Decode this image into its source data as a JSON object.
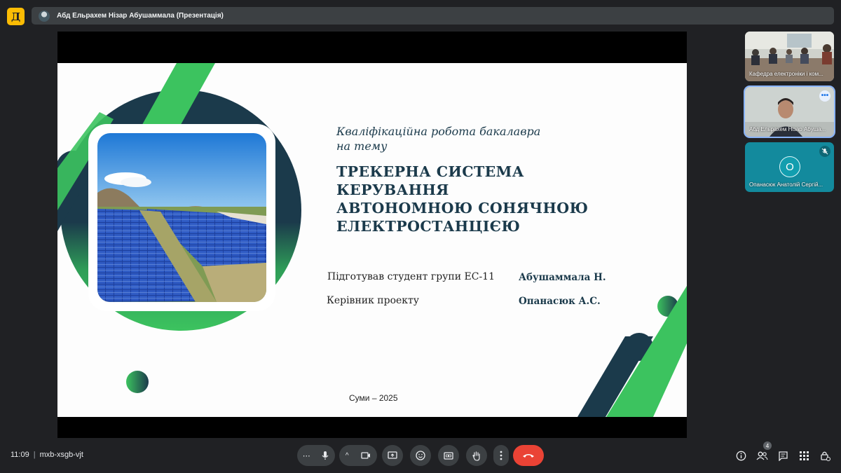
{
  "app": {
    "logo_letter": "Д"
  },
  "header": {
    "presenter_title": "Абд Ельрахем Нізар Абушаммала (Презентація)"
  },
  "slide": {
    "subtitle_line1": "Кваліфікаційна робота бакалавра",
    "subtitle_line2": "на тему",
    "title_line1": "ТРЕКЕРНА СИСТЕМА КЕРУВАННЯ",
    "title_line2": "АВТОНОМНОЮ СОНЯЧНОЮ",
    "title_line3": "ЕЛЕКТРОСТАНЦІЄЮ",
    "prepared_label": "Підготував студент групи ЕС-11",
    "prepared_value": "Абушаммала Н.",
    "supervisor_label": "Керівник проекту",
    "supervisor_value": "Опанасюк А.С.",
    "city_year": "Суми – 2025",
    "colors": {
      "green": "#3cc35f",
      "navy": "#1b3a4b"
    }
  },
  "participants": [
    {
      "name": "Кафедра електроніки і ком...",
      "active": false
    },
    {
      "name": "Абд Ельрахем Нізар Абуша...",
      "active": true,
      "more_icon": "more-horiz-icon"
    },
    {
      "name": "Опанасюк Анатолій Сергій...",
      "avatar_letter": "О",
      "active": false,
      "muted": true
    }
  ],
  "footer": {
    "time": "11:09",
    "meeting_code": "mxb-xsgb-vjt",
    "people_count": "4",
    "controls": [
      "more-audio-options",
      "mic-icon",
      "more-video-options",
      "camera-icon",
      "present-icon",
      "emoji-icon",
      "captions-icon",
      "raise-hand-icon",
      "more-options-icon",
      "end-call-icon"
    ],
    "right_icons": [
      "info-icon",
      "people-icon",
      "chat-icon",
      "activities-icon",
      "lock-icon"
    ]
  }
}
